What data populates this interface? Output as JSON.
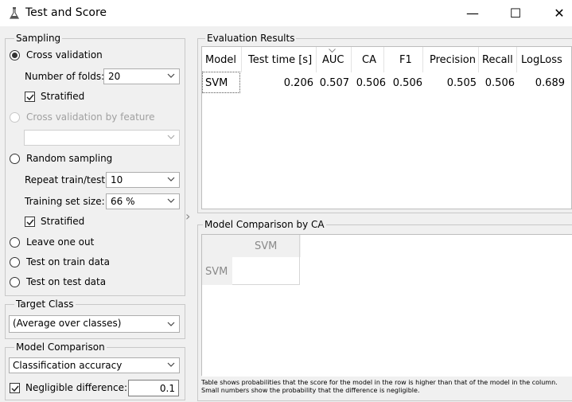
{
  "window": {
    "title": "Test and Score",
    "minimize": "—",
    "maximize": "☐",
    "close": "✕"
  },
  "sampling": {
    "title": "Sampling",
    "cross_validation": "Cross validation",
    "folds_label": "Number of folds:",
    "folds_value": "20",
    "stratified1": "Stratified",
    "cv_by_feature": "Cross validation by feature",
    "feature_value": "",
    "random_sampling": "Random sampling",
    "repeat_label": "Repeat train/test:",
    "repeat_value": "10",
    "train_size_label": "Training set size:",
    "train_size_value": "66 %",
    "stratified2": "Stratified",
    "leave_one_out": "Leave one out",
    "test_on_train": "Test on train data",
    "test_on_test": "Test on test data"
  },
  "target_class": {
    "title": "Target Class",
    "value": "(Average over classes)"
  },
  "model_comparison": {
    "title": "Model Comparison",
    "metric": "Classification accuracy",
    "negligible_label": "Negligible difference:",
    "negligible_value": "0.1"
  },
  "evaluation": {
    "title": "Evaluation Results",
    "columns": [
      "Model",
      "Test time [s]",
      "AUC",
      "CA",
      "F1",
      "Precision",
      "Recall",
      "LogLoss"
    ],
    "rows": [
      {
        "model": "SVM",
        "test_time": "0.206",
        "auc": "0.507",
        "ca": "0.506",
        "f1": "0.506",
        "precision": "0.505",
        "recall": "0.506",
        "logloss": "0.689"
      }
    ]
  },
  "comparison": {
    "title": "Model Comparison by CA",
    "col_header": "SVM",
    "row_header": "SVM",
    "note1": "Table shows probabilities that the score for the model in the row is higher than that of the model in the column.",
    "note2": "Small numbers show the probability that the difference is negligible."
  },
  "splitter": {
    "arrow": "›"
  }
}
